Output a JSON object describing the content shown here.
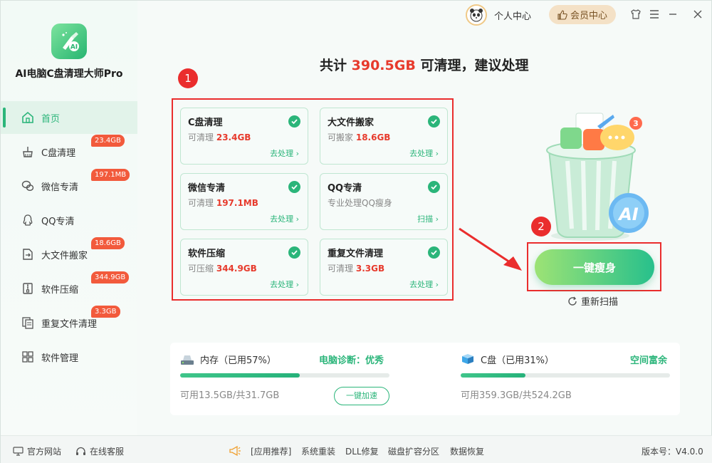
{
  "app": {
    "name": "AI电脑C盘清理大师Pro"
  },
  "sidebar": {
    "items": [
      {
        "label": "首页",
        "badge": ""
      },
      {
        "label": "C盘清理",
        "badge": "23.4GB"
      },
      {
        "label": "微信专清",
        "badge": "197.1MB"
      },
      {
        "label": "QQ专清",
        "badge": ""
      },
      {
        "label": "大文件搬家",
        "badge": "18.6GB"
      },
      {
        "label": "软件压缩",
        "badge": "344.9GB"
      },
      {
        "label": "重复文件清理",
        "badge": "3.3GB"
      },
      {
        "label": "软件管理",
        "badge": ""
      }
    ]
  },
  "topbar": {
    "user_center": "个人中心",
    "vip": "会员中心"
  },
  "headline": {
    "prefix": "共计",
    "amount": "390.5GB",
    "suffix": "可清理，建议处理"
  },
  "markers": {
    "one": "1",
    "two": "2"
  },
  "cards": [
    {
      "title": "C盘清理",
      "desc_label": "可清理",
      "value": "23.4GB",
      "action": "去处理 ›"
    },
    {
      "title": "大文件搬家",
      "desc_label": "可搬家",
      "value": "18.6GB",
      "action": "去处理 ›"
    },
    {
      "title": "微信专清",
      "desc_label": "可清理",
      "value": "197.1MB",
      "action": "去处理 ›"
    },
    {
      "title": "QQ专清",
      "desc_label": "专业处理QQ瘦身",
      "value": "",
      "action": "扫描 ›"
    },
    {
      "title": "软件压缩",
      "desc_label": "可压缩",
      "value": "344.9GB",
      "action": "去处理 ›"
    },
    {
      "title": "重复文件清理",
      "desc_label": "可清理",
      "value": "3.3GB",
      "action": "去处理 ›"
    }
  ],
  "illustration": {
    "ai_label": "AI",
    "notification_count": "3"
  },
  "cta": {
    "label": "一键瘦身",
    "rescan": "重新扫描"
  },
  "memory": {
    "title": "内存（已用57%）",
    "status": "电脑诊断：优秀",
    "used_fraction": 0.57,
    "sub": "可用13.5GB/共31.7GB",
    "button": "一键加速"
  },
  "disk": {
    "title": "C盘（已用31%）",
    "status": "空间富余",
    "used_fraction": 0.31,
    "sub": "可用359.3GB/共524.2GB"
  },
  "footer": {
    "website": "官方网站",
    "support": "在线客服",
    "recommend": "[应用推荐]",
    "links": [
      "系统重装",
      "DLL修复",
      "磁盘扩容分区",
      "数据恢复"
    ],
    "version": "版本号：V4.0.0"
  },
  "colors": {
    "accent": "#2bb57a",
    "danger": "#ea2d2d",
    "value_red": "#e73a2c"
  }
}
